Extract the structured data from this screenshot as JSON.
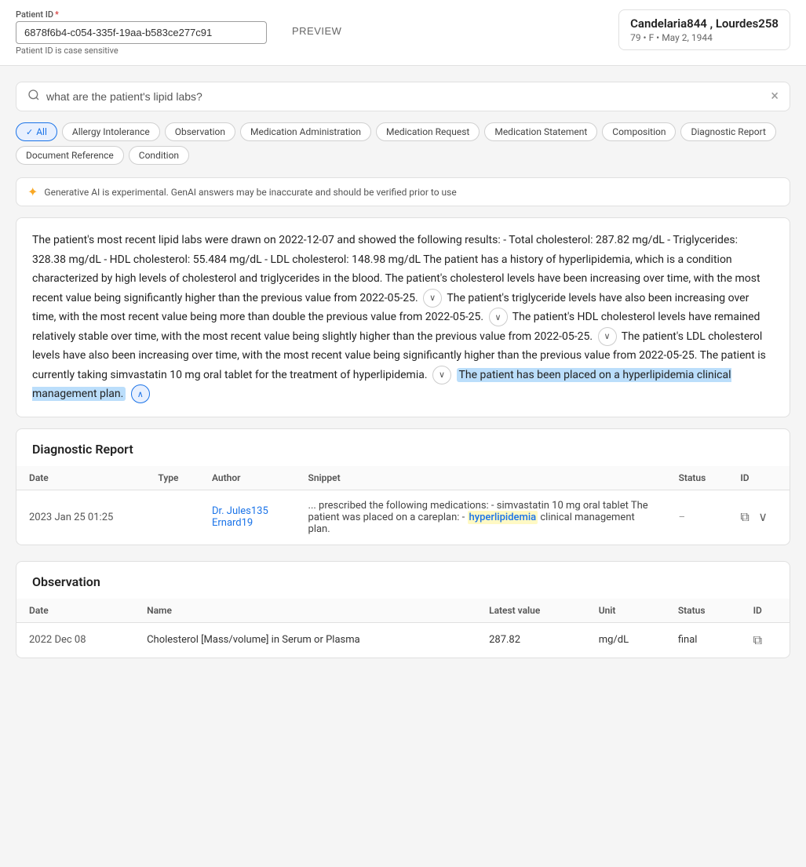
{
  "topBar": {
    "patientIdLabel": "Patient ID",
    "required": "*",
    "patientIdValue": "6878f6b4-c054-335f-19aa-b583ce277c91",
    "patientIdHint": "Patient ID is case sensitive",
    "previewLabel": "PREVIEW"
  },
  "patientInfo": {
    "name": "Candelaria844 , Lourdes258",
    "meta": "79 • F • May 2, 1944"
  },
  "searchBar": {
    "placeholder": "what are the patient's lipid labs?",
    "value": "what are the patient's lipid labs?"
  },
  "filters": [
    {
      "id": "all",
      "label": "All",
      "active": true
    },
    {
      "id": "allergy-intolerance",
      "label": "Allergy Intolerance",
      "active": false
    },
    {
      "id": "observation",
      "label": "Observation",
      "active": false
    },
    {
      "id": "medication-administration",
      "label": "Medication Administration",
      "active": false
    },
    {
      "id": "medication-request",
      "label": "Medication Request",
      "active": false
    },
    {
      "id": "medication-statement",
      "label": "Medication Statement",
      "active": false
    },
    {
      "id": "composition",
      "label": "Composition",
      "active": false
    },
    {
      "id": "diagnostic-report",
      "label": "Diagnostic Report",
      "active": false
    },
    {
      "id": "document-reference",
      "label": "Document Reference",
      "active": false
    },
    {
      "id": "condition",
      "label": "Condition",
      "active": false
    }
  ],
  "aiDisclaimer": "Generative AI is experimental. GenAI answers may be inaccurate and should be verified prior to use",
  "aiResponse": {
    "text": "The patient's most recent lipid labs were drawn on 2022-12-07 and showed the following results: - Total cholesterol: 287.82 mg/dL - Triglycerides: 328.38 mg/dL - HDL cholesterol: 55.484 mg/dL - LDL cholesterol: 148.98 mg/dL The patient has a history of hyperlipidemia, which is a condition characterized by high levels of cholesterol and triglycerides in the blood. The patient's cholesterol levels have been increasing over time, with the most recent value being significantly higher than the previous value from 2022-05-25.",
    "text2": "The patient's triglyceride levels have also been increasing over time, with the most recent value being more than double the previous value from 2022-05-25.",
    "text3": "The patient's HDL cholesterol levels have remained relatively stable over time, with the most recent value being slightly higher than the previous value from 2022-05-25.",
    "text4": "The patient's LDL cholesterol levels have also been increasing over time, with the most recent value being significantly higher than the previous value from 2022-05-25. The patient is currently taking simvastatin 10 mg oral tablet for the treatment of hyperlipidemia.",
    "text5": "The patient has been placed on a hyperlipidemia clinical management plan."
  },
  "diagnosticReport": {
    "title": "Diagnostic Report",
    "columns": [
      "Date",
      "Type",
      "Author",
      "Snippet",
      "Status",
      "ID"
    ],
    "rows": [
      {
        "date": "2023  Jan  25  01:25",
        "type": "",
        "author1": "Dr. Jules135",
        "author2": "Ernard19",
        "snippet": "... prescribed the following medications: - simvastatin 10 mg oral tablet The patient was placed on a careplan: -",
        "snippetHighlight": "hyperlipidemia",
        "snippetEnd": "clinical management plan.",
        "status": "–",
        "id": ""
      }
    ]
  },
  "observation": {
    "title": "Observation",
    "columns": [
      "Date",
      "Name",
      "Latest value",
      "Unit",
      "Status",
      "ID"
    ],
    "rows": [
      {
        "date": "2022  Dec  08",
        "name": "Cholesterol [Mass/volume] in Serum or Plasma",
        "latestValue": "287.82",
        "unit": "mg/dL",
        "status": "final",
        "id": ""
      }
    ]
  }
}
